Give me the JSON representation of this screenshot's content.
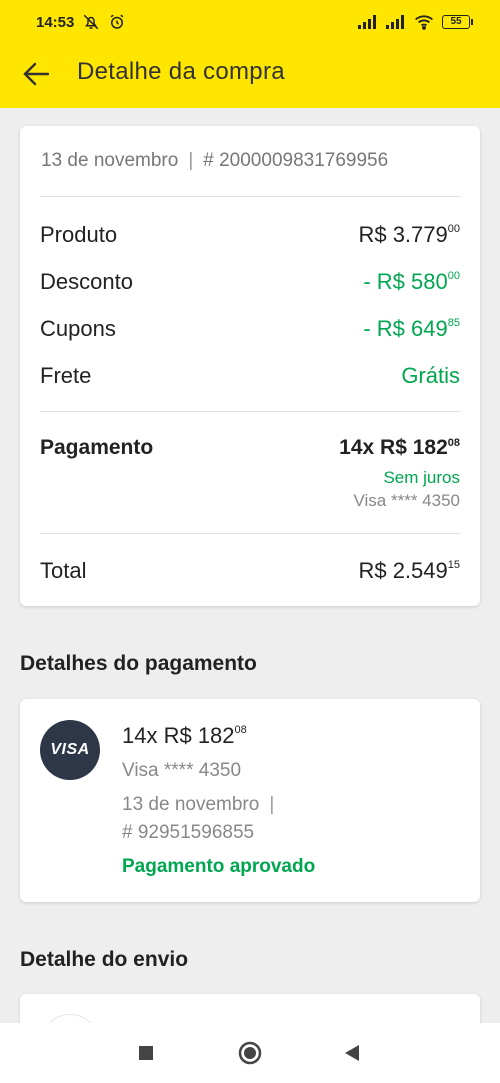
{
  "status_bar": {
    "time": "14:53",
    "battery": "55"
  },
  "app_bar": {
    "title": "Detalhe da compra"
  },
  "summary": {
    "date": "13 de novembro",
    "separator": "|",
    "order_id": "# 2000009831769956",
    "rows": [
      {
        "label": "Produto",
        "amount": "R$ 3.779",
        "cents": "00",
        "color": "#222222"
      },
      {
        "label": "Desconto",
        "amount": "- R$ 580",
        "cents": "00",
        "color": "#00a650"
      },
      {
        "label": "Cupons",
        "amount": "- R$ 649",
        "cents": "85",
        "color": "#00a650"
      },
      {
        "label": "Frete",
        "amount": "Grátis",
        "cents": "",
        "color": "#00a650"
      }
    ],
    "payment": {
      "label": "Pagamento",
      "amount": "14x R$ 182",
      "cents": "08",
      "interest": "Sem juros",
      "card": "Visa **** 4350"
    },
    "total": {
      "label": "Total",
      "amount": "R$ 2.549",
      "cents": "15"
    }
  },
  "payment_details": {
    "section_title": "Detalhes do pagamento",
    "card_brand": "VISA",
    "amount": "14x R$ 182",
    "cents": "08",
    "card": "Visa **** 4350",
    "date": "13 de novembro",
    "separator": "|",
    "transaction_id": "# 92951596855",
    "status": "Pagamento aprovado"
  },
  "shipping": {
    "section_title": "Detalhe do envio"
  },
  "colors": {
    "header_yellow": "#ffe600",
    "success_green": "#00a650",
    "visa_badge": "#2d3748"
  },
  "icons": {
    "back": "arrow-left-icon",
    "mute": "bell-off-icon",
    "alarm": "alarm-clock-icon",
    "signal": "signal-icon",
    "wifi": "wifi-icon",
    "battery": "battery-icon",
    "recents": "square-icon",
    "home": "circle-icon",
    "nav_back": "triangle-back-icon"
  }
}
